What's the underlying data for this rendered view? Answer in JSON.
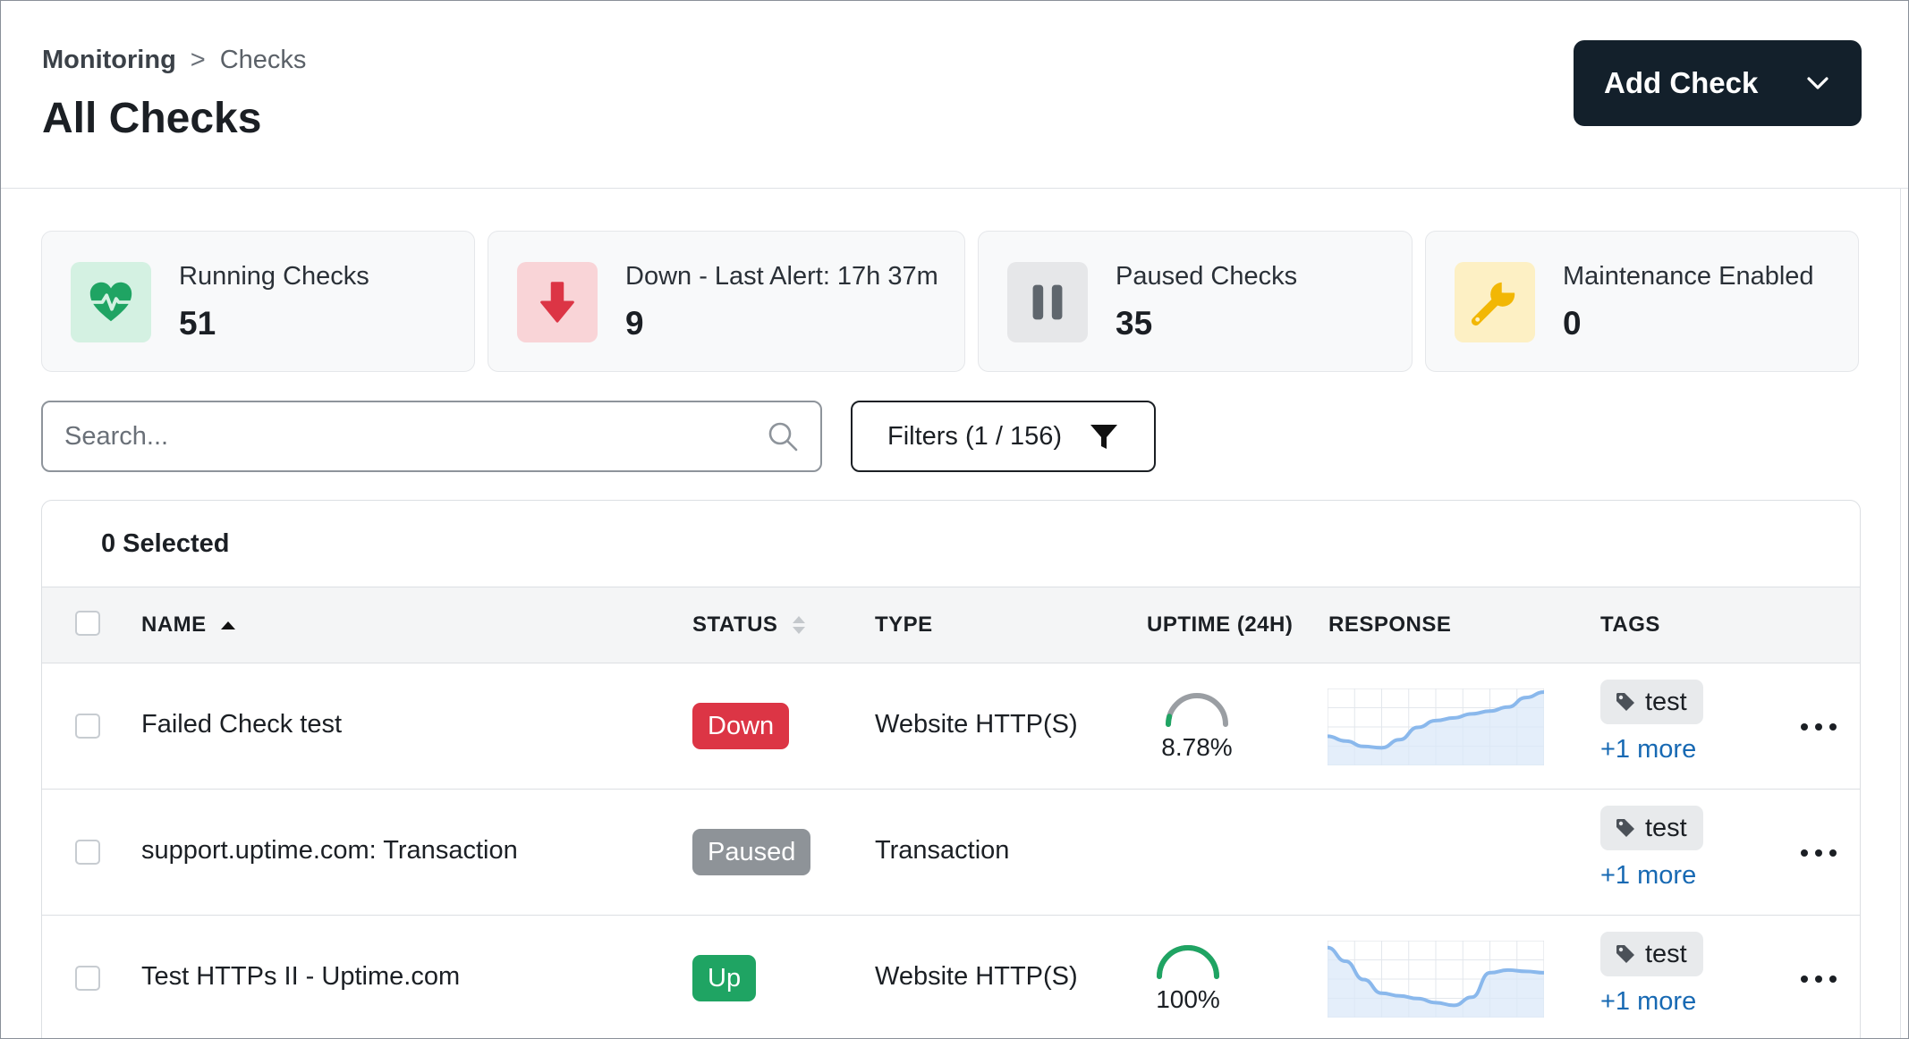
{
  "breadcrumb": {
    "root": "Monitoring",
    "separator": ">",
    "current": "Checks"
  },
  "page": {
    "title": "All Checks"
  },
  "add_check": {
    "label": "Add Check",
    "icon": "chevron-down-icon"
  },
  "stats": [
    {
      "label": "Running Checks",
      "value": "51",
      "icon": "heartbeat-icon",
      "color": "#1fa463",
      "bg": "#d4f1e2"
    },
    {
      "label": "Down - Last Alert: 17h 37m",
      "value": "9",
      "icon": "arrow-down-icon",
      "color": "#dc3545",
      "bg": "#f9d4d7"
    },
    {
      "label": "Paused Checks",
      "value": "35",
      "icon": "pause-icon",
      "color": "#5f666d",
      "bg": "#e6e7e9"
    },
    {
      "label": "Maintenance Enabled",
      "value": "0",
      "icon": "wrench-icon",
      "color": "#f2b705",
      "bg": "#fdf0c4"
    }
  ],
  "search": {
    "placeholder": "Search...",
    "value": ""
  },
  "filters": {
    "label": "Filters",
    "count": "(1 / 156)",
    "icon": "funnel-icon"
  },
  "table": {
    "selected_label": "0 Selected",
    "columns": {
      "name": "NAME",
      "status": "STATUS",
      "type": "TYPE",
      "uptime": "UPTIME (24H)",
      "response": "RESPONSE",
      "tags": "TAGS"
    },
    "sort": {
      "column": "name",
      "direction": "asc"
    },
    "rows": [
      {
        "name": "Failed Check test",
        "status": "Down",
        "status_color": "#dc3545",
        "type": "Website HTTP(S)",
        "uptime": "8.78%",
        "uptime_fraction": 0.0878,
        "gauge_color": "#1fa463",
        "response_trend": [
          0.35,
          0.28,
          0.2,
          0.18,
          0.3,
          0.48,
          0.58,
          0.62,
          0.68,
          0.72,
          0.78,
          0.92,
          1.0
        ],
        "tag": "test",
        "more": "+1 more"
      },
      {
        "name": "support.uptime.com: Transaction",
        "status": "Paused",
        "status_color": "#8e9398",
        "type": "Transaction",
        "uptime": "",
        "tag": "test",
        "more": "+1 more"
      },
      {
        "name": "Test HTTPs II - Uptime.com",
        "status": "Up",
        "status_color": "#1fa463",
        "type": "Website HTTP(S)",
        "uptime": "100%",
        "uptime_fraction": 1.0,
        "gauge_color": "#1fa463",
        "response_trend": [
          0.95,
          0.75,
          0.48,
          0.28,
          0.24,
          0.2,
          0.14,
          0.1,
          0.22,
          0.58,
          0.62,
          0.6,
          0.58
        ],
        "tag": "test",
        "more": "+1 more"
      }
    ]
  },
  "colors": {
    "accent_dark": "#13202b",
    "link": "#1769b3",
    "spark_line": "#8ab8ec",
    "spark_fill": "#dbe8f8",
    "gauge_track": "#9a9ea3"
  }
}
